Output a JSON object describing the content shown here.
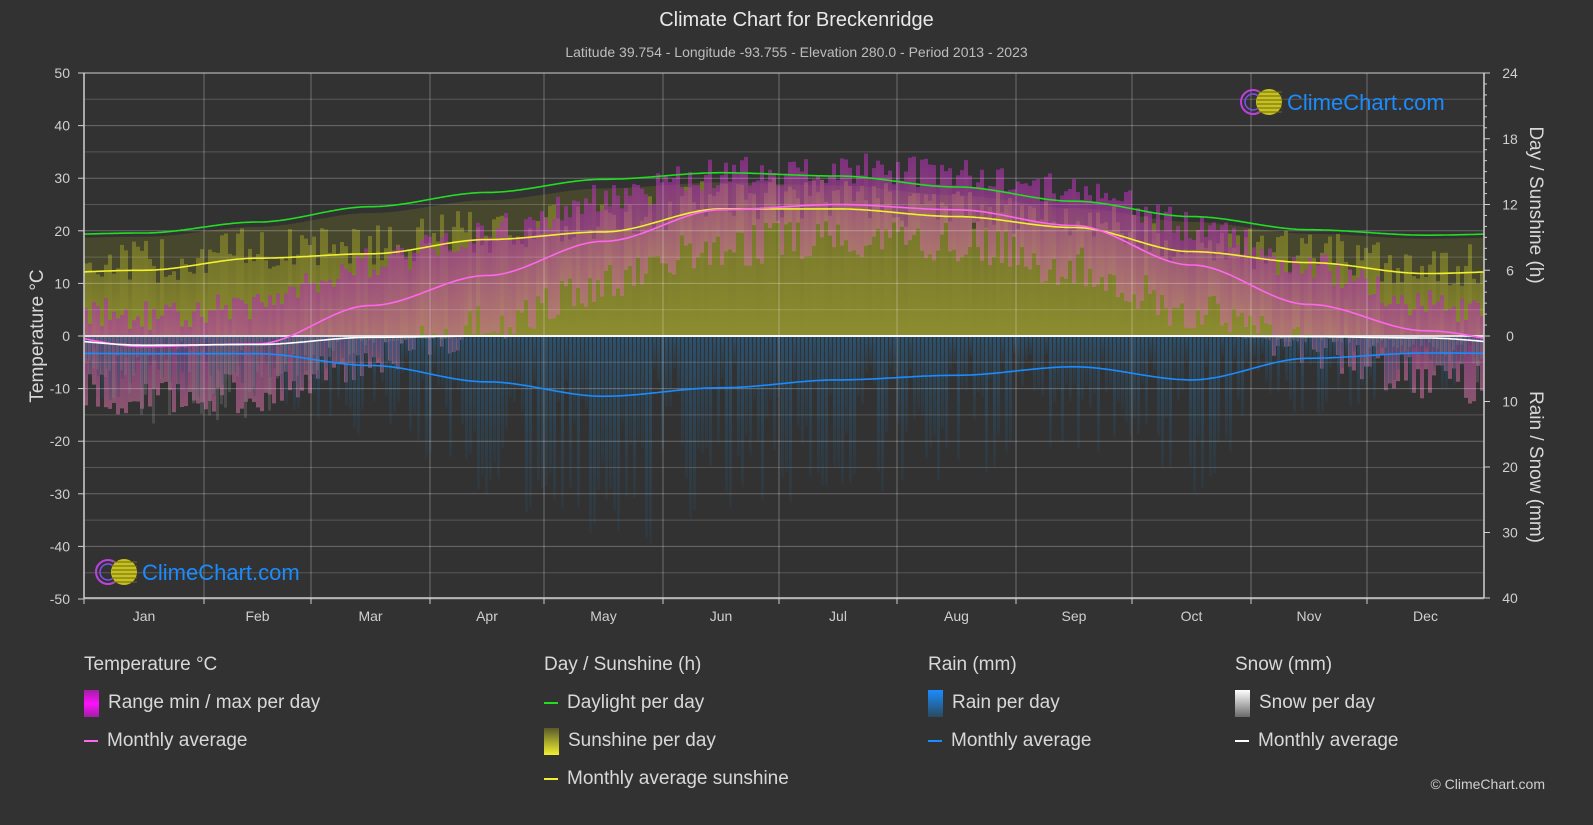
{
  "header": {
    "title": "Climate Chart for Breckenridge",
    "subtitle": "Latitude 39.754 - Longitude -93.755 - Elevation 280.0 - Period 2013 - 2023"
  },
  "watermark": {
    "text": "ClimeChart.com"
  },
  "copyright": "© ClimeChart.com",
  "colors": {
    "background": "#323232",
    "temperature_avg": "#ff66ee",
    "temperature_range": "#e020e0",
    "daylight": "#22dd22",
    "sunshine_avg": "#f0f030",
    "sunshine_fill": "#8a8a30",
    "rain_avg": "#1a8cff",
    "rain_fill": "#2a5a80",
    "snow_avg": "#ffffff",
    "snow_fill": "#8a8a8a",
    "brand": "#1a8cff"
  },
  "legend": {
    "groups": [
      {
        "title": "Temperature °C",
        "items": [
          {
            "label": "Range min / max per day",
            "kind": "box",
            "icon": "temperature-range-swatch"
          },
          {
            "label": "Monthly average",
            "kind": "line",
            "icon": "temperature-average-swatch"
          }
        ]
      },
      {
        "title": "Day / Sunshine (h)",
        "items": [
          {
            "label": "Daylight per day",
            "kind": "line",
            "icon": "daylight-swatch"
          },
          {
            "label": "Sunshine per day",
            "kind": "box",
            "icon": "sunshine-swatch"
          },
          {
            "label": "Monthly average sunshine",
            "kind": "line",
            "icon": "sunshine-average-swatch"
          }
        ]
      },
      {
        "title": "Rain (mm)",
        "items": [
          {
            "label": "Rain per day",
            "kind": "box",
            "icon": "rain-swatch"
          },
          {
            "label": "Monthly average",
            "kind": "line",
            "icon": "rain-average-swatch"
          }
        ]
      },
      {
        "title": "Snow (mm)",
        "items": [
          {
            "label": "Snow per day",
            "kind": "box",
            "icon": "snow-swatch"
          },
          {
            "label": "Monthly average",
            "kind": "line",
            "icon": "snow-average-swatch"
          }
        ]
      }
    ]
  },
  "chart_data": {
    "type": "line",
    "title": "Climate Chart for Breckenridge",
    "categories": [
      "Jan",
      "Feb",
      "Mar",
      "Apr",
      "May",
      "Jun",
      "Jul",
      "Aug",
      "Sep",
      "Oct",
      "Nov",
      "Dec"
    ],
    "left_axis": {
      "label": "Temperature °C",
      "range": [
        -50,
        50
      ],
      "ticks": [
        50,
        40,
        30,
        20,
        10,
        0,
        -10,
        -20,
        -30,
        -40,
        -50
      ]
    },
    "right_axis_top": {
      "label": "Day / Sunshine (h)",
      "range": [
        0,
        24
      ],
      "ticks": [
        24,
        18,
        12,
        6,
        0
      ]
    },
    "right_axis_bottom": {
      "label": "Rain / Snow (mm)",
      "range": [
        0,
        40
      ],
      "ticks": [
        10,
        20,
        30,
        40
      ],
      "inverted": true
    },
    "grid": true,
    "legend_position": "bottom",
    "series": [
      {
        "name": "Temperature monthly average (°C)",
        "axis": "left",
        "values": [
          -2.0,
          -1.5,
          5.8,
          11.5,
          18.0,
          24.0,
          25.0,
          24.0,
          21.0,
          13.5,
          6.0,
          1.0
        ]
      },
      {
        "name": "Temperature daily max envelope (°C)",
        "axis": "left",
        "values": [
          4,
          6,
          14,
          20,
          26,
          31,
          32,
          31,
          28,
          21,
          13,
          6
        ]
      },
      {
        "name": "Temperature daily min envelope (°C)",
        "axis": "left",
        "values": [
          -12,
          -11,
          -4,
          2,
          10,
          17,
          19,
          18,
          13,
          5,
          -2,
          -8
        ]
      },
      {
        "name": "Daylight per day (h)",
        "axis": "right_top",
        "values": [
          9.4,
          10.4,
          11.8,
          13.1,
          14.3,
          14.9,
          14.6,
          13.6,
          12.3,
          10.9,
          9.7,
          9.2
        ]
      },
      {
        "name": "Monthly average sunshine (h)",
        "axis": "right_top",
        "values": [
          6.0,
          7.1,
          7.5,
          8.8,
          9.5,
          11.6,
          11.6,
          10.9,
          9.9,
          7.7,
          6.7,
          5.7
        ]
      },
      {
        "name": "Rain monthly average (mm)",
        "axis": "right_bottom",
        "values": [
          2.7,
          2.7,
          4.5,
          7.0,
          9.2,
          7.9,
          6.7,
          6.0,
          4.7,
          6.7,
          3.4,
          2.6
        ]
      },
      {
        "name": "Snow monthly average (mm)",
        "axis": "right_bottom",
        "values": [
          1.4,
          1.3,
          0.2,
          0.0,
          0.0,
          0.0,
          0.0,
          0.0,
          0.0,
          0.0,
          0.1,
          0.3
        ]
      }
    ]
  }
}
